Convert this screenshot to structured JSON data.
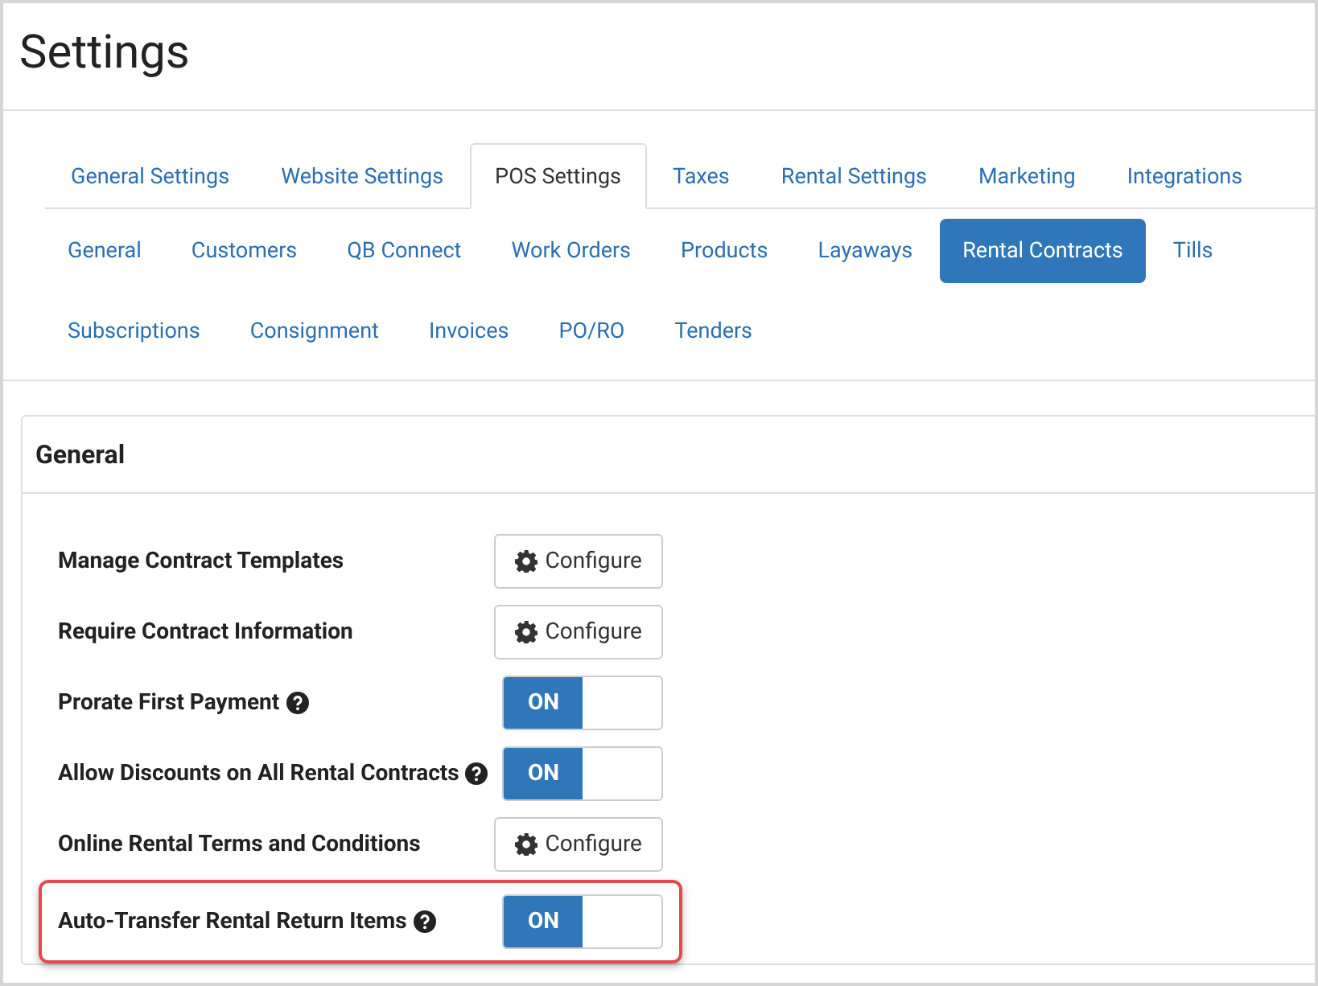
{
  "title": "Settings",
  "tabs": [
    {
      "label": "General Settings",
      "selected": false
    },
    {
      "label": "Website Settings",
      "selected": false
    },
    {
      "label": "POS Settings",
      "selected": true
    },
    {
      "label": "Taxes",
      "selected": false
    },
    {
      "label": "Rental Settings",
      "selected": false
    },
    {
      "label": "Marketing",
      "selected": false
    },
    {
      "label": "Integrations",
      "selected": false
    }
  ],
  "subtabs": [
    {
      "label": "General",
      "selected": false
    },
    {
      "label": "Customers",
      "selected": false
    },
    {
      "label": "QB Connect",
      "selected": false
    },
    {
      "label": "Work Orders",
      "selected": false
    },
    {
      "label": "Products",
      "selected": false
    },
    {
      "label": "Layaways",
      "selected": false
    },
    {
      "label": "Rental Contracts",
      "selected": true
    },
    {
      "label": "Tills",
      "selected": false
    },
    {
      "label": "Subscriptions",
      "selected": false
    },
    {
      "label": "Consignment",
      "selected": false
    },
    {
      "label": "Invoices",
      "selected": false
    },
    {
      "label": "PO/RO",
      "selected": false
    },
    {
      "label": "Tenders",
      "selected": false
    }
  ],
  "panel": {
    "title": "General",
    "rows": [
      {
        "label": "Manage Contract Templates",
        "kind": "configure",
        "button": "Configure",
        "help": false,
        "highlighted": false
      },
      {
        "label": "Require Contract Information",
        "kind": "configure",
        "button": "Configure",
        "help": false,
        "highlighted": false
      },
      {
        "label": "Prorate First Payment",
        "kind": "toggle",
        "toggle_label": "ON",
        "on": true,
        "help": true,
        "highlighted": false
      },
      {
        "label": "Allow Discounts on All Rental Contracts",
        "kind": "toggle",
        "toggle_label": "ON",
        "on": true,
        "help": true,
        "highlighted": false
      },
      {
        "label": "Online Rental Terms and Conditions",
        "kind": "configure",
        "button": "Configure",
        "help": false,
        "highlighted": false
      },
      {
        "label": "Auto-Transfer Rental Return Items",
        "kind": "toggle",
        "toggle_label": "ON",
        "on": true,
        "help": true,
        "highlighted": true
      }
    ]
  }
}
